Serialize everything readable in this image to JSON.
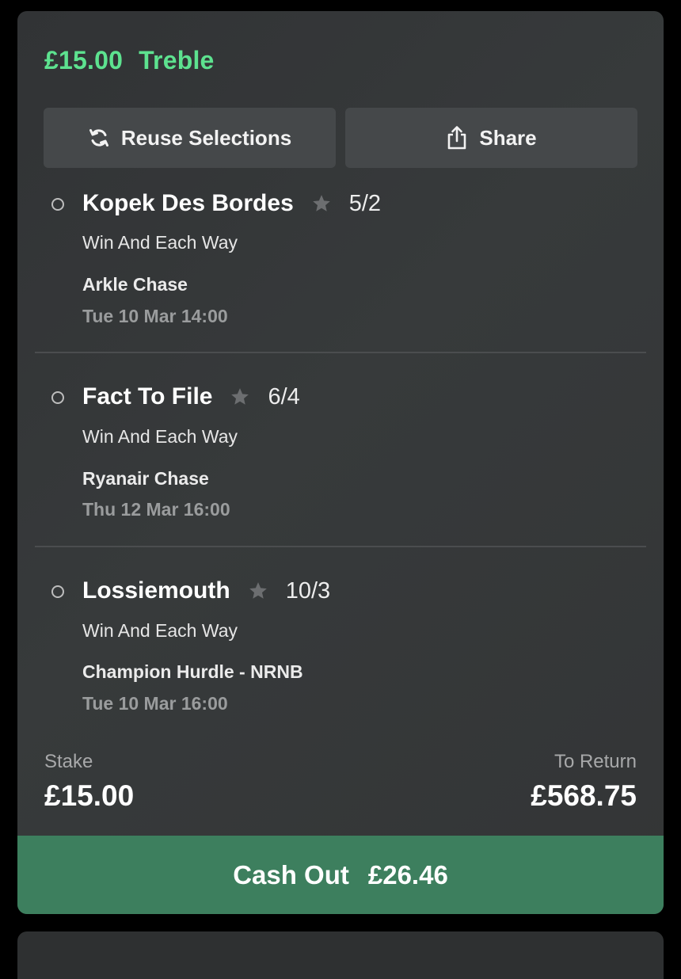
{
  "bet": {
    "amount": "£15.00",
    "type": "Treble"
  },
  "actions": {
    "reuse_label": "Reuse Selections",
    "share_label": "Share"
  },
  "selections": [
    {
      "name": "Kopek Des Bordes",
      "odds": "5/2",
      "market": "Win And Each Way",
      "event": "Arkle Chase",
      "time": "Tue 10 Mar 14:00"
    },
    {
      "name": "Fact To File",
      "odds": "6/4",
      "market": "Win And Each Way",
      "event": "Ryanair Chase",
      "time": "Thu 12 Mar 16:00"
    },
    {
      "name": "Lossiemouth",
      "odds": "10/3",
      "market": "Win And Each Way",
      "event": "Champion Hurdle - NRNB",
      "time": "Tue 10 Mar 16:00"
    }
  ],
  "summary": {
    "stake_label": "Stake",
    "stake_value": "£15.00",
    "return_label": "To Return",
    "return_value": "£568.75"
  },
  "cashout": {
    "label": "Cash Out",
    "value": "£26.46"
  },
  "colors": {
    "accent_green": "#5de28f",
    "cashout_green": "#3d7f5e",
    "card_bg": "#333536"
  },
  "icons": {
    "reuse": "refresh-icon",
    "share": "share-icon",
    "favourite": "star-icon",
    "selection_status": "radio-circle-icon"
  }
}
